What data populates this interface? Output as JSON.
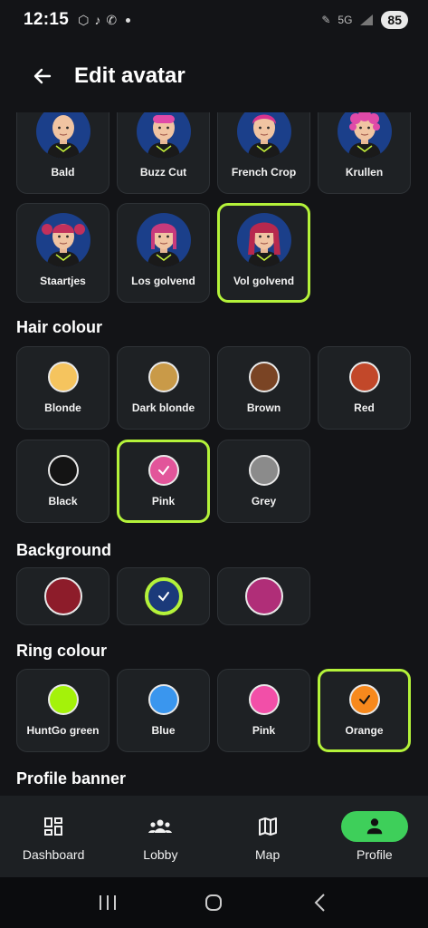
{
  "status": {
    "time": "12:15",
    "network": "5G",
    "battery": "85"
  },
  "header": {
    "title": "Edit avatar"
  },
  "hair_styles": [
    {
      "label": "Bald"
    },
    {
      "label": "Buzz Cut"
    },
    {
      "label": "French Crop"
    },
    {
      "label": "Krullen"
    },
    {
      "label": "Staartjes"
    },
    {
      "label": "Los golvend"
    },
    {
      "label": "Vol golvend",
      "selected": true
    }
  ],
  "hair_colour": {
    "title": "Hair colour",
    "options": [
      {
        "label": "Blonde",
        "color": "#f5c45e"
      },
      {
        "label": "Dark blonde",
        "color": "#c99a48"
      },
      {
        "label": "Brown",
        "color": "#7a4424"
      },
      {
        "label": "Red",
        "color": "#c2482a"
      },
      {
        "label": "Black",
        "color": "#141414"
      },
      {
        "label": "Pink",
        "color": "#e2559a",
        "selected": true
      },
      {
        "label": "Grey",
        "color": "#8b8b8b"
      }
    ]
  },
  "background": {
    "title": "Background",
    "options": [
      {
        "color": "#8d1c2a"
      },
      {
        "color": "#1b3a7a",
        "selected": true
      },
      {
        "color": "#b02e78"
      }
    ]
  },
  "ring_colour": {
    "title": "Ring colour",
    "options": [
      {
        "label": "HuntGo green",
        "color": "#a4f20a"
      },
      {
        "label": "Blue",
        "color": "#3a96ee"
      },
      {
        "label": "Pink",
        "color": "#f24fa8"
      },
      {
        "label": "Orange",
        "color": "#f7891d",
        "selected": true
      }
    ]
  },
  "profile_banner": {
    "title": "Profile banner"
  },
  "nav": [
    {
      "label": "Dashboard",
      "icon": "dashboard-icon"
    },
    {
      "label": "Lobby",
      "icon": "group-icon"
    },
    {
      "label": "Map",
      "icon": "map-icon"
    },
    {
      "label": "Profile",
      "icon": "person-icon",
      "active": true
    }
  ],
  "colors": {
    "accent": "#b4f23a",
    "nav_active": "#3ecf5a",
    "card_bg": "#1e2124",
    "page_bg": "#131417"
  }
}
